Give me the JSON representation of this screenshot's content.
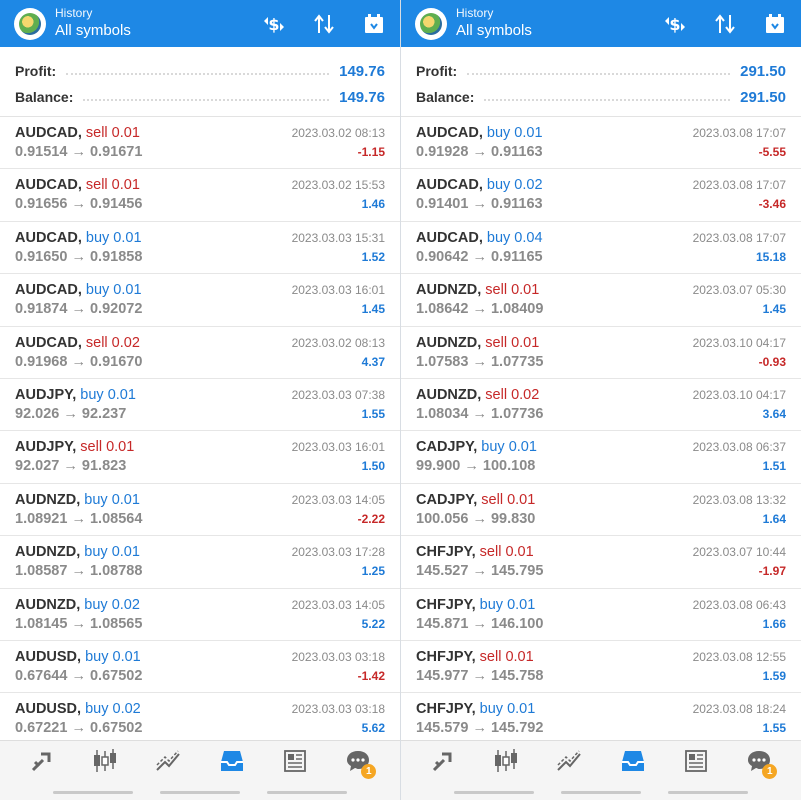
{
  "colors": {
    "accent": "#1e88e5",
    "buy": "#1e7ad6",
    "sell": "#c62828",
    "badge": "#f5a623"
  },
  "panes": [
    {
      "header": {
        "small": "History",
        "title": "All symbols"
      },
      "summary": {
        "profit_label": "Profit:",
        "profit": "149.76",
        "balance_label": "Balance:",
        "balance": "149.76"
      },
      "trades": [
        {
          "symbol": "AUDCAD,",
          "side": "sell 0.01",
          "type": "sell",
          "prices": "0.91514 → 0.91671",
          "time": "2023.03.02 08:13",
          "pl": "-1.15"
        },
        {
          "symbol": "AUDCAD,",
          "side": "sell 0.01",
          "type": "sell",
          "prices": "0.91656 → 0.91456",
          "time": "2023.03.02 15:53",
          "pl": "1.46"
        },
        {
          "symbol": "AUDCAD,",
          "side": "buy 0.01",
          "type": "buy",
          "prices": "0.91650 → 0.91858",
          "time": "2023.03.03 15:31",
          "pl": "1.52"
        },
        {
          "symbol": "AUDCAD,",
          "side": "buy 0.01",
          "type": "buy",
          "prices": "0.91874 → 0.92072",
          "time": "2023.03.03 16:01",
          "pl": "1.45"
        },
        {
          "symbol": "AUDCAD,",
          "side": "sell 0.02",
          "type": "sell",
          "prices": "0.91968 → 0.91670",
          "time": "2023.03.02 08:13",
          "pl": "4.37"
        },
        {
          "symbol": "AUDJPY,",
          "side": "buy 0.01",
          "type": "buy",
          "prices": "92.026 → 92.237",
          "time": "2023.03.03 07:38",
          "pl": "1.55"
        },
        {
          "symbol": "AUDJPY,",
          "side": "sell 0.01",
          "type": "sell",
          "prices": "92.027 → 91.823",
          "time": "2023.03.03 16:01",
          "pl": "1.50"
        },
        {
          "symbol": "AUDNZD,",
          "side": "buy 0.01",
          "type": "buy",
          "prices": "1.08921 → 1.08564",
          "time": "2023.03.03 14:05",
          "pl": "-2.22"
        },
        {
          "symbol": "AUDNZD,",
          "side": "buy 0.01",
          "type": "buy",
          "prices": "1.08587 → 1.08788",
          "time": "2023.03.03 17:28",
          "pl": "1.25"
        },
        {
          "symbol": "AUDNZD,",
          "side": "buy 0.02",
          "type": "buy",
          "prices": "1.08145 → 1.08565",
          "time": "2023.03.03 14:05",
          "pl": "5.22"
        },
        {
          "symbol": "AUDUSD,",
          "side": "buy 0.01",
          "type": "buy",
          "prices": "0.67644 → 0.67502",
          "time": "2023.03.03 03:18",
          "pl": "-1.42"
        },
        {
          "symbol": "AUDUSD,",
          "side": "buy 0.02",
          "type": "buy",
          "prices": "0.67221 → 0.67502",
          "time": "2023.03.03 03:18",
          "pl": "5.62"
        }
      ]
    },
    {
      "header": {
        "small": "History",
        "title": "All symbols"
      },
      "summary": {
        "profit_label": "Profit:",
        "profit": "291.50",
        "balance_label": "Balance:",
        "balance": "291.50"
      },
      "trades": [
        {
          "symbol": "AUDCAD,",
          "side": "buy 0.01",
          "type": "buy",
          "prices": "0.91928 → 0.91163",
          "time": "2023.03.08 17:07",
          "pl": "-5.55"
        },
        {
          "symbol": "AUDCAD,",
          "side": "buy 0.02",
          "type": "buy",
          "prices": "0.91401 → 0.91163",
          "time": "2023.03.08 17:07",
          "pl": "-3.46"
        },
        {
          "symbol": "AUDCAD,",
          "side": "buy 0.04",
          "type": "buy",
          "prices": "0.90642 → 0.91165",
          "time": "2023.03.08 17:07",
          "pl": "15.18"
        },
        {
          "symbol": "AUDNZD,",
          "side": "sell 0.01",
          "type": "sell",
          "prices": "1.08642 → 1.08409",
          "time": "2023.03.07 05:30",
          "pl": "1.45"
        },
        {
          "symbol": "AUDNZD,",
          "side": "sell 0.01",
          "type": "sell",
          "prices": "1.07583 → 1.07735",
          "time": "2023.03.10 04:17",
          "pl": "-0.93"
        },
        {
          "symbol": "AUDNZD,",
          "side": "sell 0.02",
          "type": "sell",
          "prices": "1.08034 → 1.07736",
          "time": "2023.03.10 04:17",
          "pl": "3.64"
        },
        {
          "symbol": "CADJPY,",
          "side": "buy 0.01",
          "type": "buy",
          "prices": "99.900 → 100.108",
          "time": "2023.03.08 06:37",
          "pl": "1.51"
        },
        {
          "symbol": "CADJPY,",
          "side": "sell 0.01",
          "type": "sell",
          "prices": "100.056 → 99.830",
          "time": "2023.03.08 13:32",
          "pl": "1.64"
        },
        {
          "symbol": "CHFJPY,",
          "side": "sell 0.01",
          "type": "sell",
          "prices": "145.527 → 145.795",
          "time": "2023.03.07 10:44",
          "pl": "-1.97"
        },
        {
          "symbol": "CHFJPY,",
          "side": "buy 0.01",
          "type": "buy",
          "prices": "145.871 → 146.100",
          "time": "2023.03.08 06:43",
          "pl": "1.66"
        },
        {
          "symbol": "CHFJPY,",
          "side": "sell 0.01",
          "type": "sell",
          "prices": "145.977 → 145.758",
          "time": "2023.03.08 12:55",
          "pl": "1.59"
        },
        {
          "symbol": "CHFJPY,",
          "side": "buy 0.01",
          "type": "buy",
          "prices": "145.579 → 145.792",
          "time": "2023.03.08 18:24",
          "pl": "1.55"
        }
      ]
    }
  ],
  "nav": {
    "items": [
      {
        "icon": "trade-icon"
      },
      {
        "icon": "chart-candles-icon"
      },
      {
        "icon": "trend-icon"
      },
      {
        "icon": "history-inbox-icon",
        "active": true
      },
      {
        "icon": "news-icon"
      },
      {
        "icon": "chat-icon",
        "badge": "1"
      }
    ]
  }
}
